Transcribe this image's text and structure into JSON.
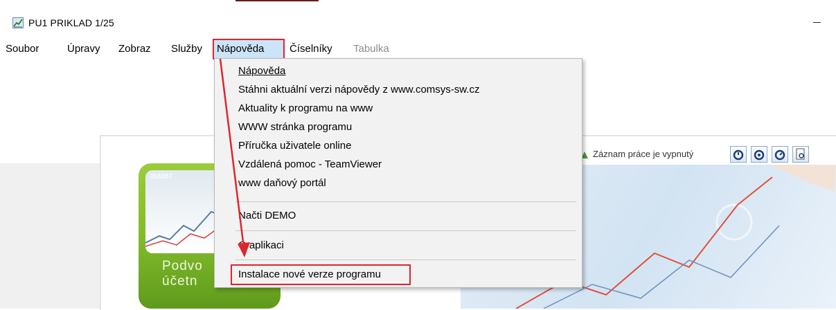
{
  "window": {
    "title": "PU1 PRIKLAD 1/25"
  },
  "menubar": {
    "items": [
      {
        "label": "Soubor"
      },
      {
        "label": "Úpravy"
      },
      {
        "label": "Zobraz"
      },
      {
        "label": "Služby"
      },
      {
        "label": "Nápověda"
      },
      {
        "label": "Číselníky"
      },
      {
        "label": "Tabulka"
      }
    ],
    "active": "Nápověda",
    "disabled": "Tabulka"
  },
  "help_menu": {
    "items": [
      {
        "label": "Nápověda"
      },
      {
        "label": "Stáhni aktuální verzi nápovědy z www.comsys-sw.cz"
      },
      {
        "label": "Aktuality k programu na www"
      },
      {
        "label": "WWW stránka programu"
      },
      {
        "label": "Příručka uživatele online"
      },
      {
        "label": "Vzdálená pomoc - TeamViewer"
      },
      {
        "label": "www daňový portál"
      },
      {
        "label": "Načti DEMO"
      },
      {
        "label": "O aplikaci"
      },
      {
        "label": "Instalace nové verze programu"
      }
    ]
  },
  "background": {
    "tile_number": "356087",
    "tile_text_1": "Podvo",
    "tile_text_2": "účetn",
    "record_status": "Záznam práce je vypnutý"
  },
  "annotations": {
    "highlight_color": "#e0242c"
  }
}
